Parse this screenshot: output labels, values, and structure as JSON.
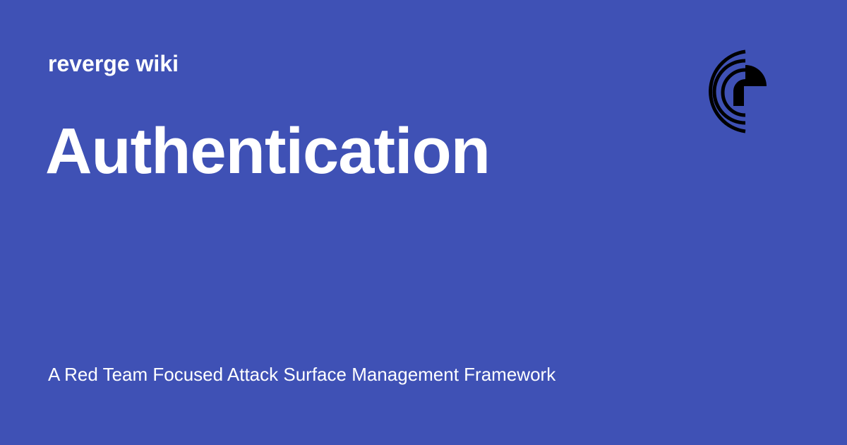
{
  "site": {
    "name": "reverge wiki"
  },
  "page": {
    "title": "Authentication",
    "description": "A Red Team Focused Attack Surface Management Framework"
  },
  "logo": {
    "icon": "reverge-logo-icon",
    "color": "#000000"
  },
  "colors": {
    "background": "#3f51b5",
    "text": "#ffffff"
  }
}
